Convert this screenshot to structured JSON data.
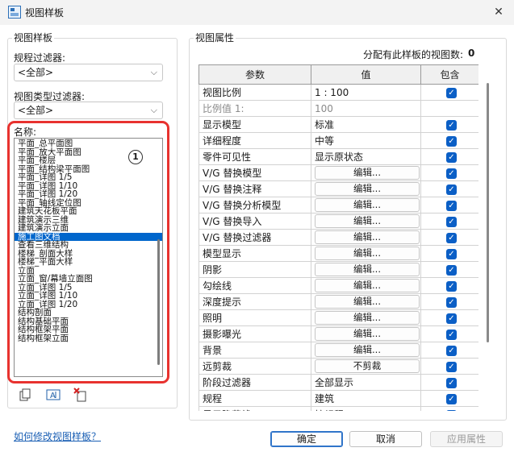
{
  "window": {
    "title": "视图样板",
    "close_glyph": "✕"
  },
  "left_panel": {
    "group_title": "视图样板",
    "discipline_filter": {
      "label": "规程过滤器:",
      "value": "<全部>"
    },
    "view_type_filter": {
      "label": "视图类型过滤器:",
      "value": "<全部>"
    },
    "names_label": "名称:",
    "names": [
      "平面_总平面图",
      "平面_放大平面图",
      "平面_楼层",
      "平面_结构梁平面图",
      "平面_详图 1/5",
      "平面_详图 1/10",
      "平面_详图 1/20",
      "平面_轴线定位图",
      "建筑天花板平面",
      "建筑演示三维",
      "建筑演示立面",
      "施工图文档",
      "查看三维结构",
      "楼梯_剖面大样",
      "楼梯_平面大样",
      "立面",
      "立面_窗/幕墙立面图",
      "立面_详图 1/5",
      "立面_详图 1/10",
      "立面_详图 1/20",
      "结构剖面",
      "结构基础平面",
      "结构框架平面",
      "结构框架立面"
    ],
    "selected_index": 11,
    "callout_number": "1",
    "tools": {
      "duplicate_icon": "duplicate-icon",
      "rename_icon": "rename-icon",
      "delete_icon": "delete-icon"
    }
  },
  "right_panel": {
    "group_title": "视图属性",
    "assigned_count_label": "分配有此样板的视图数:",
    "assigned_count": "0",
    "columns": [
      "参数",
      "值",
      "包含"
    ],
    "rows": [
      {
        "param": "视图比例",
        "value": "1 : 100",
        "kind": "text",
        "include": true
      },
      {
        "param": "比例值 1:",
        "value": "100",
        "kind": "gray",
        "include": null
      },
      {
        "param": "显示模型",
        "value": "标准",
        "kind": "text",
        "include": true
      },
      {
        "param": "详细程度",
        "value": "中等",
        "kind": "text",
        "include": true
      },
      {
        "param": "零件可见性",
        "value": "显示原状态",
        "kind": "text",
        "include": true
      },
      {
        "param": "V/G 替换模型",
        "value": "编辑...",
        "kind": "button",
        "include": true
      },
      {
        "param": "V/G 替换注释",
        "value": "编辑...",
        "kind": "button",
        "include": true
      },
      {
        "param": "V/G 替换分析模型",
        "value": "编辑...",
        "kind": "button",
        "include": true
      },
      {
        "param": "V/G 替换导入",
        "value": "编辑...",
        "kind": "button",
        "include": true
      },
      {
        "param": "V/G 替换过滤器",
        "value": "编辑...",
        "kind": "button",
        "include": true
      },
      {
        "param": "模型显示",
        "value": "编辑...",
        "kind": "button",
        "include": true
      },
      {
        "param": "阴影",
        "value": "编辑...",
        "kind": "button",
        "include": true
      },
      {
        "param": "勾绘线",
        "value": "编辑...",
        "kind": "button",
        "include": true
      },
      {
        "param": "深度提示",
        "value": "编辑...",
        "kind": "button",
        "include": true
      },
      {
        "param": "照明",
        "value": "编辑...",
        "kind": "button",
        "include": true
      },
      {
        "param": "摄影曝光",
        "value": "编辑...",
        "kind": "button",
        "include": true
      },
      {
        "param": "背景",
        "value": "编辑...",
        "kind": "button",
        "include": true
      },
      {
        "param": "远剪裁",
        "value": "不剪裁",
        "kind": "button",
        "include": true
      },
      {
        "param": "阶段过滤器",
        "value": "全部显示",
        "kind": "text",
        "include": true
      },
      {
        "param": "规程",
        "value": "建筑",
        "kind": "text",
        "include": true
      },
      {
        "param": "显示隐藏线",
        "value": "按规程",
        "kind": "text",
        "include": true
      }
    ]
  },
  "footer": {
    "help_link": "如何修改视图样板？",
    "ok": "确定",
    "cancel": "取消",
    "apply": "应用属性"
  }
}
